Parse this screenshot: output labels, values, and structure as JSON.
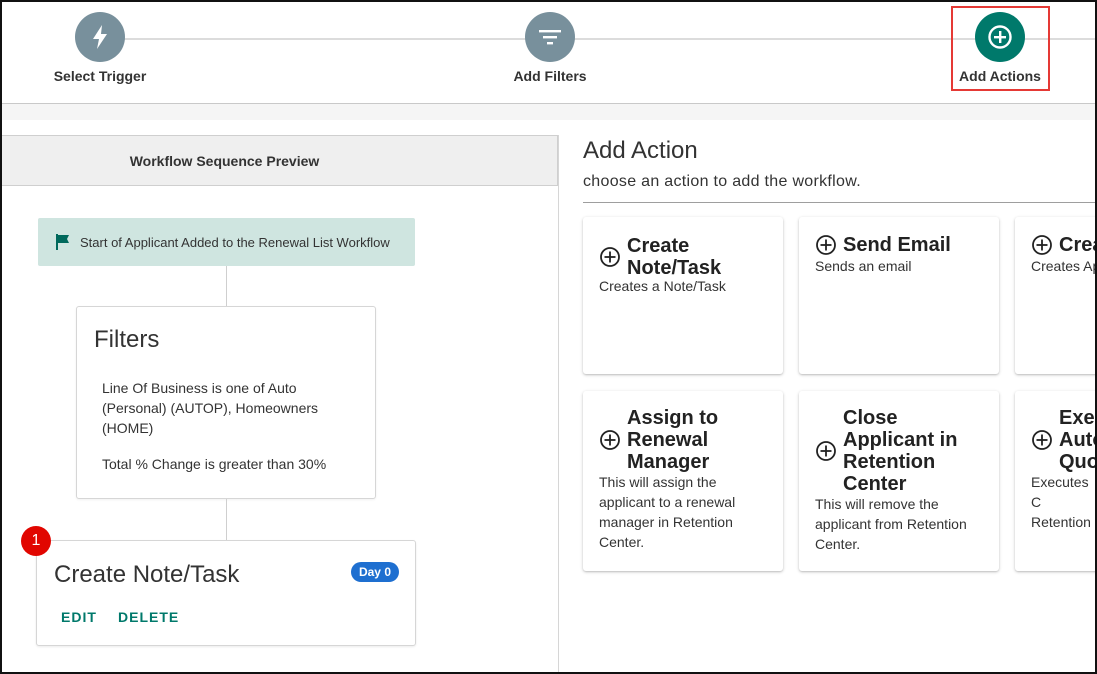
{
  "stepper": {
    "steps": [
      {
        "label": "Select Trigger",
        "icon": "bolt-icon"
      },
      {
        "label": "Add Filters",
        "icon": "filter-icon"
      },
      {
        "label": "Add Actions",
        "icon": "plus-circle-icon"
      }
    ],
    "active_step": 3,
    "active_color": "#00796b",
    "inactive_color": "#78909c",
    "highlight_color": "#e53935"
  },
  "preview": {
    "header": "Workflow Sequence Preview",
    "start": "Start of Applicant Added to the Renewal List Workflow",
    "filters": {
      "title": "Filters",
      "conditions": [
        "Line Of Business is one of Auto (Personal) (AUTOP), Homeowners (HOME)",
        "Total % Change is greater than 30%"
      ]
    },
    "action": {
      "number": "1",
      "title": "Create Note/Task",
      "day_badge": "Day 0",
      "edit_label": "EDIT",
      "delete_label": "DELETE"
    }
  },
  "add_action": {
    "title": "Add Action",
    "subtitle": "choose an action to add the workflow.",
    "options": [
      {
        "title_lines": [
          "Create",
          "Note/Task"
        ],
        "description": "Creates a Note/Task"
      },
      {
        "title_lines": [
          "Send Email"
        ],
        "description": "Sends an email"
      },
      {
        "title_lines": [
          "Create"
        ],
        "description": "Creates Ap"
      },
      {
        "title_lines": [
          "Assign to",
          "Renewal",
          "Manager"
        ],
        "description": "This will assign the applicant to a renewal manager in Retention Center."
      },
      {
        "title_lines": [
          "Close",
          "Applicant in",
          "Retention",
          "Center"
        ],
        "description": "This will remove the applicant from Retention Center."
      },
      {
        "title_lines": [
          "Exec",
          "Auto",
          "Quo"
        ],
        "description": "Executes C Retention"
      }
    ]
  },
  "colors": {
    "teal": "#00796b",
    "start_bg": "#cfe5e0",
    "badge_blue": "#1e6fd0",
    "badge_red": "#e10600"
  }
}
